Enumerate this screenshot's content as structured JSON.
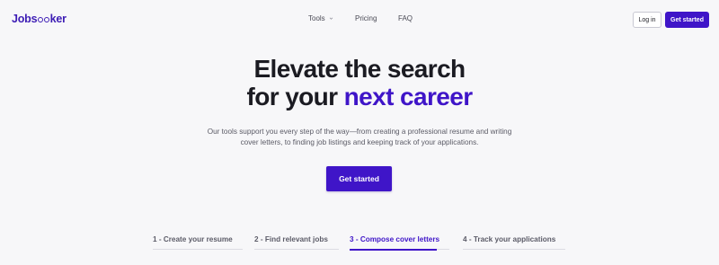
{
  "brand": {
    "name_prefix": "Jobs",
    "name_eyes": "ee",
    "name_suffix": "ker",
    "color": "#3d1db5"
  },
  "nav": {
    "items": [
      {
        "label": "Tools",
        "has_dropdown": true
      },
      {
        "label": "Pricing"
      },
      {
        "label": "FAQ"
      }
    ],
    "login_label": "Log in",
    "get_started_label": "Get started"
  },
  "hero": {
    "title_line1": "Elevate the search",
    "title_line2_prefix": "for your ",
    "title_line2_accent": "next career",
    "subtitle_line1": "Our tools support you every step of the way—from creating a professional resume and writing",
    "subtitle_line2": "cover letters, to finding job listings and keeping track of your applications.",
    "cta_label": "Get started"
  },
  "tabs": [
    {
      "label": "1 - Create your resume",
      "active": false
    },
    {
      "label": "2 - Find relevant jobs",
      "active": false
    },
    {
      "label": "3 - Compose cover letters",
      "active": true,
      "progress": 0.87
    },
    {
      "label": "4 - Track your applications",
      "active": false
    }
  ],
  "colors": {
    "accent": "#3f15c8",
    "background": "#f7f7f9",
    "text": "#1b1b22"
  }
}
